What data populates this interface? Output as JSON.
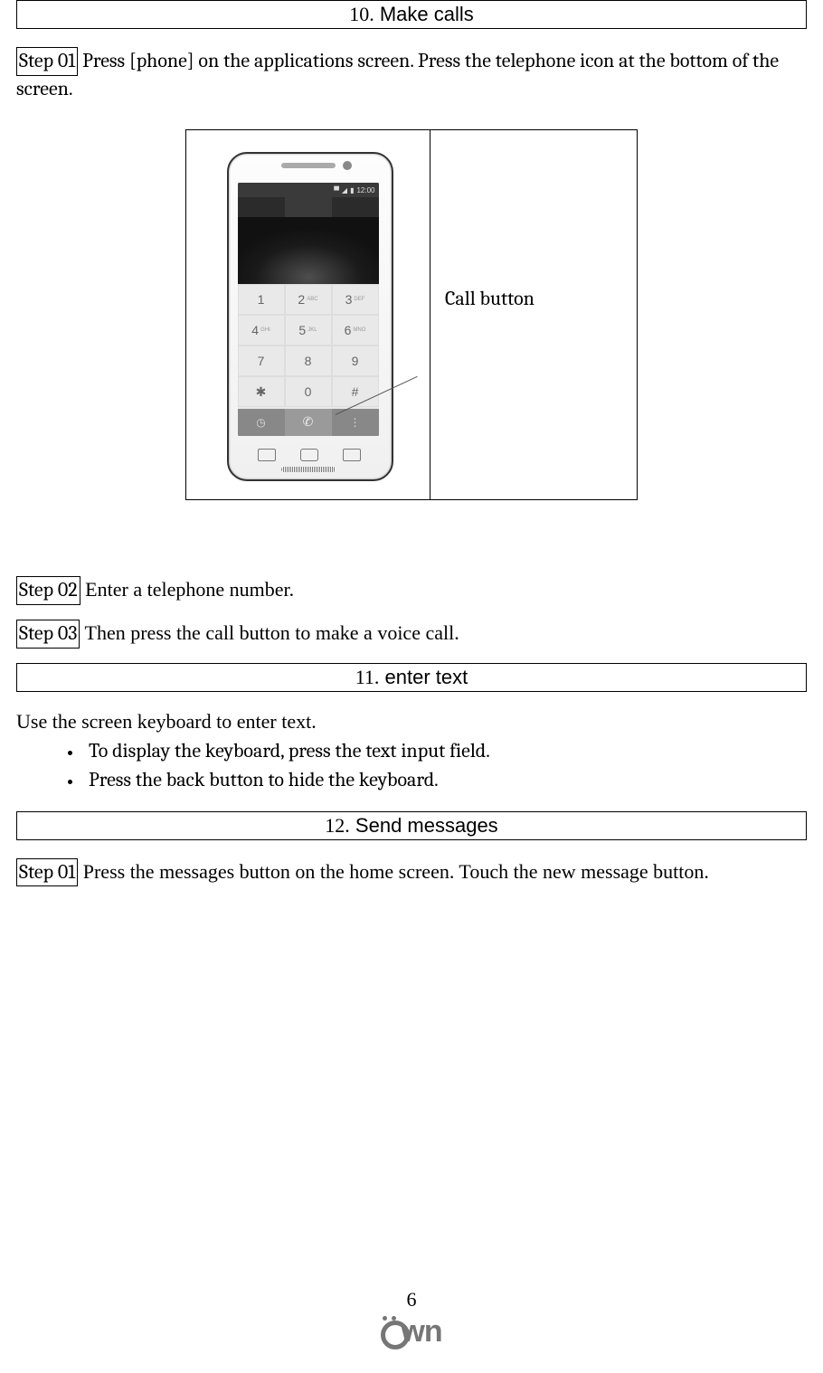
{
  "sections": {
    "s10": {
      "num": "10.",
      "title": "Make calls"
    },
    "s11": {
      "num": "11.",
      "title": "enter text"
    },
    "s12": {
      "num": "12.",
      "title": "Send messages"
    }
  },
  "s10_steps": {
    "step01_label": "Step 01",
    "step01_text": " Press [phone] on the applications screen. Press the telephone icon at the bottom of the screen.",
    "step02_label": "Step 02",
    "step02_text": " Enter a telephone number.",
    "step03_label": "Step 03",
    "step03_text": " Then press the call button to make a voice call."
  },
  "figure": {
    "callout": "Call button",
    "status_time": "12:00",
    "keypad": [
      "1",
      "2",
      "3",
      "4",
      "5",
      "6",
      "7",
      "8",
      "9",
      "",
      "0",
      ""
    ]
  },
  "s11_body": {
    "intro": "Use the screen keyboard to enter text.",
    "bullets": [
      "To display the keyboard, press the text input field.",
      "Press the back button to hide the keyboard."
    ]
  },
  "s12_steps": {
    "step01_label": "Step 01",
    "step01_text": " Press the messages button on the home screen. Touch the new message button."
  },
  "footer": {
    "page_number": "6",
    "brand": "own"
  }
}
